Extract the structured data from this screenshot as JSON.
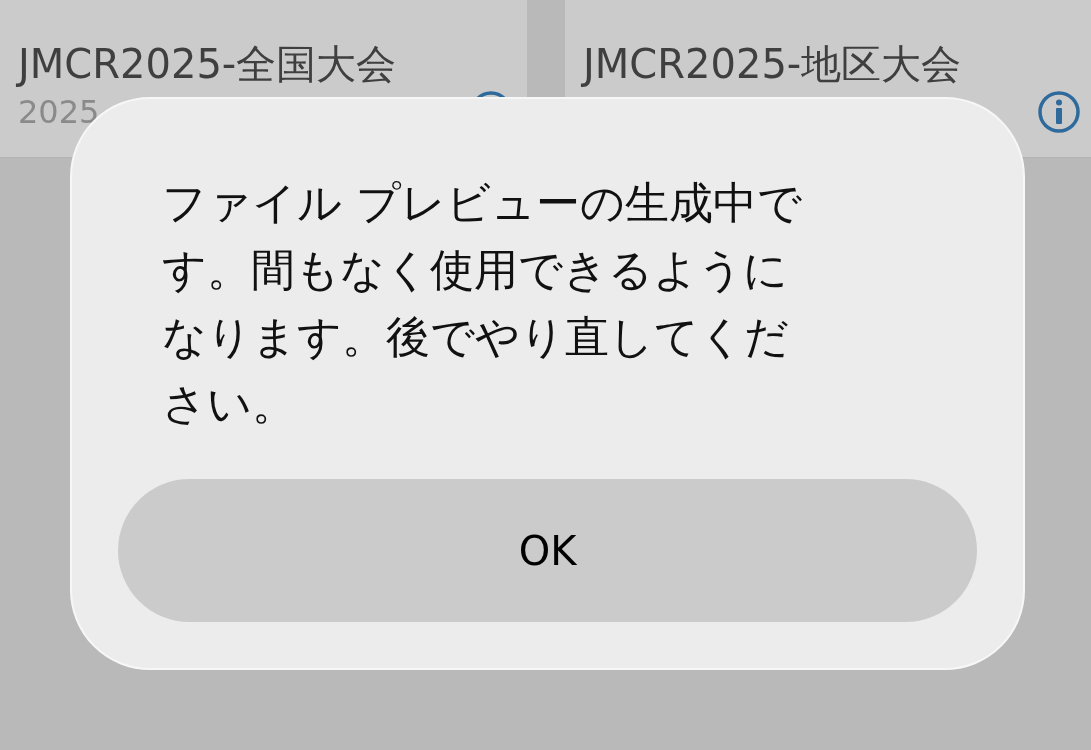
{
  "cards": [
    {
      "title": "JMCR2025-全国大会",
      "subtitle": "2025"
    },
    {
      "title": "JMCR2025-地区大会"
    }
  ],
  "alert": {
    "message": "ファイル プレビューの生成中です。間もなく使用できるようになります。後でやり直してください。",
    "buttons": [
      "OK"
    ]
  }
}
